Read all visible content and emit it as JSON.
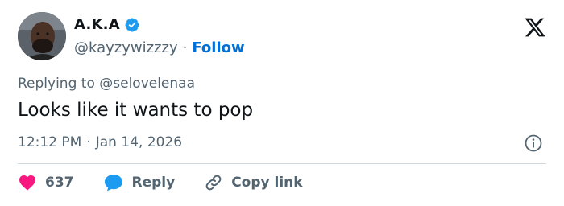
{
  "author": {
    "display_name": "A.K.A",
    "handle": "@kayzywizzzy",
    "separator": "·",
    "follow_label": "Follow"
  },
  "reply_context": {
    "prefix": "Replying to",
    "mention": "@selovelenaa"
  },
  "tweet": {
    "text": "Looks like it wants to pop",
    "time": "12:12 PM",
    "separator": "·",
    "date": "Jan 14, 2026"
  },
  "actions": {
    "like_count": "637",
    "reply_label": "Reply",
    "copy_link_label": "Copy link"
  },
  "icons": {
    "verified": "verified-badge-icon",
    "logo": "x-logo-icon",
    "info": "info-icon",
    "like": "heart-icon",
    "reply": "speech-bubble-icon",
    "copy": "link-icon"
  },
  "colors": {
    "accent": "#1d9bf0",
    "follow": "#006fd6",
    "heart": "#f91880",
    "secondary_text": "#536471",
    "primary_text": "#0f1419",
    "divider": "#cfd9de"
  }
}
